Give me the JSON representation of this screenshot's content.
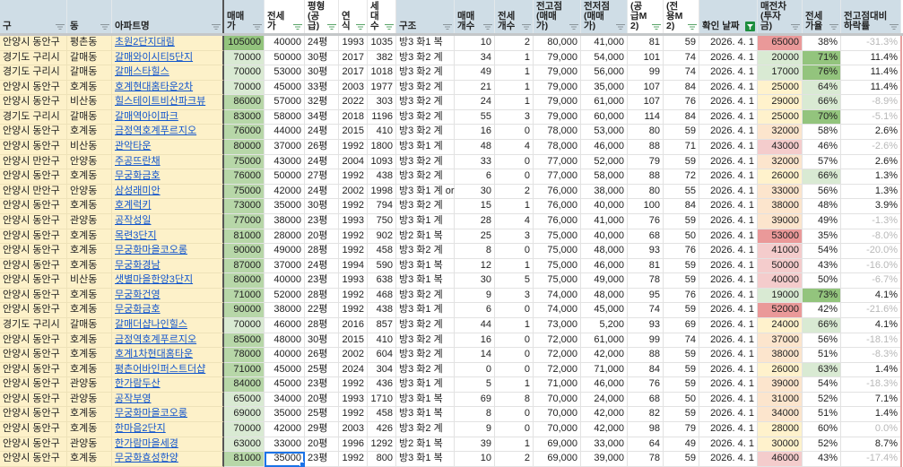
{
  "headers": [
    "구",
    "동",
    "아파트명",
    "매매가",
    "전세가",
    "평형(공급)",
    "연식",
    "세대수",
    "구조",
    "매매개수",
    "전세개수",
    "전고점(매매가)",
    "전저점(매매가)",
    "(공급M2)",
    "(전용M2)",
    "확인 날짜",
    "매전차(투자금)",
    "전세가율",
    "전고점대비하락률"
  ],
  "header_icons": {
    "filter": "filter-icon",
    "active_filter": "filter-active-icon"
  },
  "colors": {
    "accent": "#1a73e8",
    "link": "#1155cc",
    "header_bg": "#cfdde6",
    "key_bg": "#fdf1c9",
    "green_dark": "#93c47d",
    "green_mid": "#b7d7a8",
    "green_light": "#d9ead3",
    "red": "#ea9999",
    "pink": "#f4cccc",
    "peach": "#fce5cd",
    "yellow": "#fff2cc"
  },
  "rows": [
    [
      "안양시 동안구",
      "평촌동",
      "초원2단지대림",
      "105000",
      "40000",
      "24평",
      "1993",
      "1035",
      "방3 화1 복",
      "10",
      "2",
      "80,000",
      "41,000",
      "81",
      "59",
      "2026. 4. 1",
      "65000",
      "38%",
      "-31.3%"
    ],
    [
      "경기도 구리시",
      "갈매동",
      "갈매와이시티5단지",
      "70000",
      "50000",
      "30평",
      "2017",
      "382",
      "방3 화2 계",
      "34",
      "1",
      "79,000",
      "54,000",
      "101",
      "74",
      "2026. 4. 1",
      "20000",
      "71%",
      "11.4%"
    ],
    [
      "경기도 구리시",
      "갈매동",
      "갈매스타힐스",
      "70000",
      "53000",
      "30평",
      "2017",
      "1018",
      "방3 화2 계",
      "49",
      "1",
      "79,000",
      "56,000",
      "99",
      "74",
      "2026. 4. 1",
      "17000",
      "76%",
      "11.4%"
    ],
    [
      "안양시 동안구",
      "호계동",
      "호계현대홈타운2차",
      "70000",
      "45000",
      "33평",
      "2003",
      "1977",
      "방3 화2 계",
      "21",
      "1",
      "79,000",
      "35,000",
      "107",
      "84",
      "2026. 4. 1",
      "25000",
      "64%",
      "11.4%"
    ],
    [
      "안양시 동안구",
      "비산동",
      "힐스테이트비산파크뷰",
      "86000",
      "57000",
      "32평",
      "2022",
      "303",
      "방3 화2 계",
      "24",
      "1",
      "79,000",
      "61,000",
      "107",
      "76",
      "2026. 4. 1",
      "29000",
      "66%",
      "-8.9%"
    ],
    [
      "경기도 구리시",
      "갈매동",
      "갈매역아이파크",
      "83000",
      "58000",
      "34평",
      "2018",
      "1196",
      "방3 화2 계",
      "55",
      "3",
      "79,000",
      "60,000",
      "114",
      "84",
      "2026. 4. 1",
      "25000",
      "70%",
      "-5.1%"
    ],
    [
      "안양시 동안구",
      "호계동",
      "금정역호계푸르지오",
      "76000",
      "44000",
      "24평",
      "2015",
      "410",
      "방3 화2 계",
      "16",
      "0",
      "78,000",
      "53,000",
      "80",
      "59",
      "2026. 4. 1",
      "32000",
      "58%",
      "2.6%"
    ],
    [
      "안양시 동안구",
      "비산동",
      "관악타운",
      "80000",
      "37000",
      "26평",
      "1992",
      "1800",
      "방3 화1 계",
      "48",
      "4",
      "78,000",
      "46,000",
      "88",
      "71",
      "2026. 4. 1",
      "43000",
      "46%",
      "-2.6%"
    ],
    [
      "안양시 만안구",
      "안양동",
      "주공뜨란채",
      "75000",
      "43000",
      "24평",
      "2004",
      "1093",
      "방3 화2 계",
      "33",
      "0",
      "77,000",
      "52,000",
      "79",
      "59",
      "2026. 4. 1",
      "32000",
      "57%",
      "2.6%"
    ],
    [
      "안양시 동안구",
      "호계동",
      "무궁화금호",
      "76000",
      "50000",
      "27평",
      "1992",
      "438",
      "방3 화2 계",
      "6",
      "0",
      "77,000",
      "58,000",
      "88",
      "72",
      "2026. 4. 1",
      "26000",
      "66%",
      "1.3%"
    ],
    [
      "안양시 만안구",
      "안양동",
      "삼성래미안",
      "75000",
      "42000",
      "24평",
      "2002",
      "1998",
      "방3 화1 계 or",
      "30",
      "2",
      "76,000",
      "38,000",
      "80",
      "55",
      "2026. 4. 1",
      "33000",
      "56%",
      "1.3%"
    ],
    [
      "안양시 동안구",
      "호계동",
      "호계럭키",
      "73000",
      "35000",
      "30평",
      "1992",
      "794",
      "방3 화2 계",
      "15",
      "1",
      "76,000",
      "40,000",
      "100",
      "84",
      "2026. 4. 1",
      "38000",
      "48%",
      "3.9%"
    ],
    [
      "안양시 동안구",
      "관양동",
      "공작성일",
      "77000",
      "38000",
      "23평",
      "1993",
      "750",
      "방3 화1 계",
      "28",
      "4",
      "76,000",
      "41,000",
      "76",
      "59",
      "2026. 4. 1",
      "39000",
      "49%",
      "-1.3%"
    ],
    [
      "안양시 동안구",
      "호계동",
      "목련3단지",
      "81000",
      "28000",
      "20평",
      "1992",
      "902",
      "방2 화1 복",
      "25",
      "3",
      "75,000",
      "40,000",
      "68",
      "50",
      "2026. 4. 1",
      "53000",
      "35%",
      "-8.0%"
    ],
    [
      "안양시 동안구",
      "호계동",
      "무궁화마을코오롱",
      "90000",
      "49000",
      "28평",
      "1992",
      "458",
      "방3 화2 계",
      "8",
      "0",
      "75,000",
      "48,000",
      "93",
      "76",
      "2026. 4. 1",
      "41000",
      "54%",
      "-20.0%"
    ],
    [
      "안양시 동안구",
      "호계동",
      "무궁화경남",
      "87000",
      "37000",
      "24평",
      "1994",
      "590",
      "방3 화1 복",
      "12",
      "1",
      "75,000",
      "46,000",
      "81",
      "59",
      "2026. 4. 1",
      "50000",
      "43%",
      "-16.0%"
    ],
    [
      "안양시 동안구",
      "비산동",
      "샛별마을한양3단지",
      "80000",
      "40000",
      "23평",
      "1993",
      "638",
      "방3 화1 복",
      "30",
      "5",
      "75,000",
      "49,000",
      "78",
      "59",
      "2026. 4. 1",
      "40000",
      "50%",
      "-6.7%"
    ],
    [
      "안양시 동안구",
      "호계동",
      "무궁화건영",
      "71000",
      "52000",
      "28평",
      "1992",
      "468",
      "방3 화2 계",
      "9",
      "3",
      "74,000",
      "48,000",
      "95",
      "76",
      "2026. 4. 1",
      "19000",
      "73%",
      "4.1%"
    ],
    [
      "안양시 동안구",
      "호계동",
      "무궁화금호",
      "90000",
      "38000",
      "22평",
      "1992",
      "438",
      "방3 화1 계",
      "6",
      "0",
      "74,000",
      "45,000",
      "74",
      "59",
      "2026. 4. 1",
      "52000",
      "42%",
      "-21.6%"
    ],
    [
      "경기도 구리시",
      "갈매동",
      "갈매더샵나인힐스",
      "70000",
      "46000",
      "28평",
      "2016",
      "857",
      "방3 화2 계",
      "44",
      "1",
      "73,000",
      "5,200",
      "93",
      "69",
      "2026. 4. 1",
      "24000",
      "66%",
      "4.1%"
    ],
    [
      "안양시 동안구",
      "호계동",
      "금정역호계푸르지오",
      "85000",
      "48000",
      "30평",
      "2015",
      "410",
      "방3 화2 계",
      "16",
      "0",
      "72,000",
      "61,000",
      "99",
      "74",
      "2026. 4. 1",
      "37000",
      "56%",
      "-18.1%"
    ],
    [
      "안양시 동안구",
      "호계동",
      "호계1차현대홈타운",
      "78000",
      "40000",
      "26평",
      "2002",
      "604",
      "방3 화2 계",
      "14",
      "0",
      "72,000",
      "42,000",
      "88",
      "59",
      "2026. 4. 1",
      "38000",
      "51%",
      "-8.3%"
    ],
    [
      "안양시 동안구",
      "호계동",
      "평촌어바인퍼스트더샵",
      "71000",
      "45000",
      "25평",
      "2024",
      "304",
      "방3 화2 계",
      "0",
      "0",
      "72,000",
      "71,000",
      "84",
      "59",
      "2026. 4. 1",
      "26000",
      "63%",
      "1.4%"
    ],
    [
      "안양시 동안구",
      "관양동",
      "한가람두산",
      "84000",
      "45000",
      "23평",
      "1992",
      "436",
      "방3 화1 계",
      "5",
      "1",
      "71,000",
      "46,000",
      "76",
      "59",
      "2026. 4. 1",
      "39000",
      "54%",
      "-18.3%"
    ],
    [
      "안양시 동안구",
      "관양동",
      "공작부영",
      "65000",
      "34000",
      "20평",
      "1993",
      "1710",
      "방3 화1 복",
      "69",
      "8",
      "70,000",
      "24,000",
      "68",
      "50",
      "2026. 4. 1",
      "31000",
      "52%",
      "7.1%"
    ],
    [
      "안양시 동안구",
      "호계동",
      "무궁화마을코오롱",
      "69000",
      "35000",
      "25평",
      "1992",
      "458",
      "방3 화1 복",
      "8",
      "0",
      "70,000",
      "42,000",
      "82",
      "59",
      "2026. 4. 1",
      "34000",
      "51%",
      "1.4%"
    ],
    [
      "안양시 동안구",
      "호계동",
      "한마음2단지",
      "70000",
      "42000",
      "29평",
      "2003",
      "426",
      "방3 화2 계",
      "9",
      "0",
      "70,000",
      "42,000",
      "98",
      "79",
      "2026. 4. 1",
      "28000",
      "60%",
      "0.0%"
    ],
    [
      "안양시 동안구",
      "관양동",
      "한가람마을세경",
      "63000",
      "33000",
      "20평",
      "1996",
      "1292",
      "방2 화1 복",
      "39",
      "1",
      "69,000",
      "33,000",
      "64",
      "49",
      "2026. 4. 1",
      "30000",
      "52%",
      "8.7%"
    ],
    [
      "안양시 동안구",
      "호계동",
      "무궁화효성한양",
      "81000",
      "35000",
      "23평",
      "1992",
      "800",
      "방3 화1 복",
      "10",
      "2",
      "69,000",
      "39,000",
      "78",
      "59",
      "2026. 4. 1",
      "46000",
      "43%",
      "-17.4%"
    ]
  ]
}
